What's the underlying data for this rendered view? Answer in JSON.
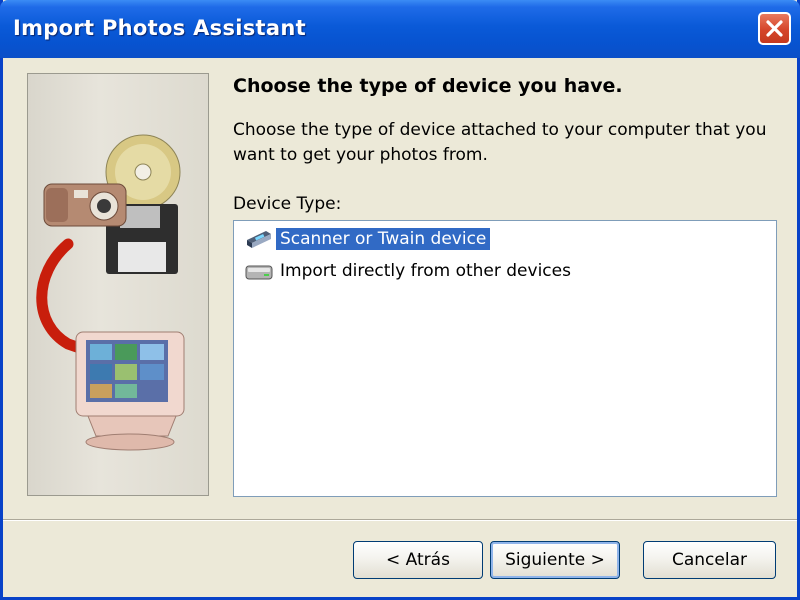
{
  "window": {
    "title": "Import Photos Assistant"
  },
  "page": {
    "heading": "Choose the type of device you have.",
    "description": "Choose the type of device attached to your computer that you want to get your photos from.",
    "list_label": "Device Type:"
  },
  "device_types": [
    {
      "label": "Scanner or Twain device",
      "icon": "scanner-icon",
      "selected": true
    },
    {
      "label": "Import directly from other devices",
      "icon": "device-drive-icon",
      "selected": false
    }
  ],
  "buttons": {
    "back": "< Atrás",
    "next": "Siguiente >",
    "cancel": "Cancelar"
  },
  "colors": {
    "titlebar": "#0a5ad8",
    "selection": "#316ac5",
    "close": "#d5452a",
    "face": "#ece9d8"
  }
}
